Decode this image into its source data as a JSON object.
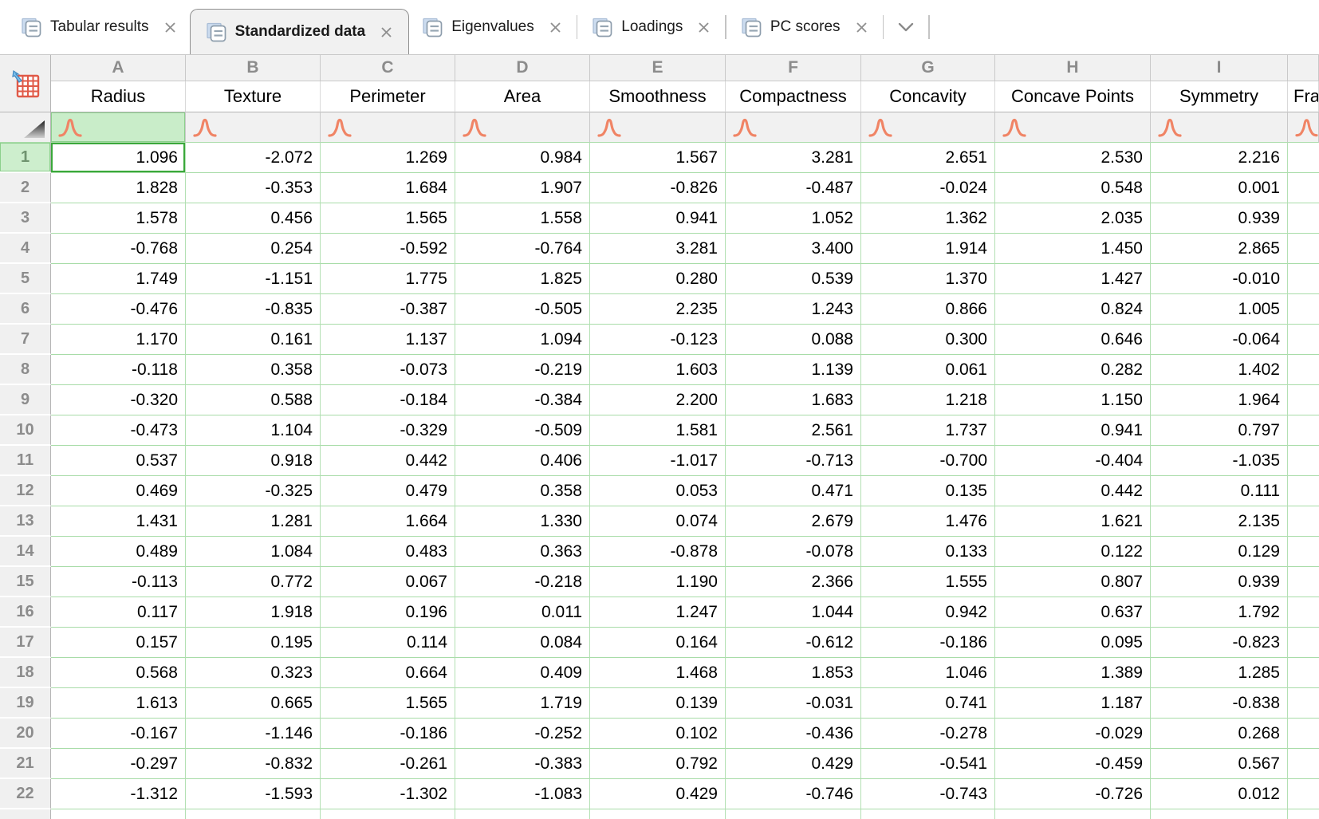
{
  "tabs": {
    "items": [
      {
        "label": "Tabular results",
        "active": false
      },
      {
        "label": "Standardized data",
        "active": true
      },
      {
        "label": "Eigenvalues",
        "active": false
      },
      {
        "label": "Loadings",
        "active": false
      },
      {
        "label": "PC scores",
        "active": false
      }
    ],
    "has_overflow_chevron": true
  },
  "sheet": {
    "column_letters": [
      "A",
      "B",
      "C",
      "D",
      "E",
      "F",
      "G",
      "H",
      "I"
    ],
    "column_names": [
      "Radius",
      "Texture",
      "Perimeter",
      "Area",
      "Smoothness",
      "Compactness",
      "Concavity",
      "Concave Points",
      "Symmetry"
    ],
    "clipped_column_label": "Fra",
    "selection": {
      "row": 1,
      "column": "A"
    },
    "row_numbers": [
      1,
      2,
      3,
      4,
      5,
      6,
      7,
      8,
      9,
      10,
      11,
      12,
      13,
      14,
      15,
      16,
      17,
      18,
      19,
      20,
      21,
      22
    ],
    "rows": [
      [
        "1.096",
        "-2.072",
        "1.269",
        "0.984",
        "1.567",
        "3.281",
        "2.651",
        "2.530",
        "2.216"
      ],
      [
        "1.828",
        "-0.353",
        "1.684",
        "1.907",
        "-0.826",
        "-0.487",
        "-0.024",
        "0.548",
        "0.001"
      ],
      [
        "1.578",
        "0.456",
        "1.565",
        "1.558",
        "0.941",
        "1.052",
        "1.362",
        "2.035",
        "0.939"
      ],
      [
        "-0.768",
        "0.254",
        "-0.592",
        "-0.764",
        "3.281",
        "3.400",
        "1.914",
        "1.450",
        "2.865"
      ],
      [
        "1.749",
        "-1.151",
        "1.775",
        "1.825",
        "0.280",
        "0.539",
        "1.370",
        "1.427",
        "-0.010"
      ],
      [
        "-0.476",
        "-0.835",
        "-0.387",
        "-0.505",
        "2.235",
        "1.243",
        "0.866",
        "0.824",
        "1.005"
      ],
      [
        "1.170",
        "0.161",
        "1.137",
        "1.094",
        "-0.123",
        "0.088",
        "0.300",
        "0.646",
        "-0.064"
      ],
      [
        "-0.118",
        "0.358",
        "-0.073",
        "-0.219",
        "1.603",
        "1.139",
        "0.061",
        "0.282",
        "1.402"
      ],
      [
        "-0.320",
        "0.588",
        "-0.184",
        "-0.384",
        "2.200",
        "1.683",
        "1.218",
        "1.150",
        "1.964"
      ],
      [
        "-0.473",
        "1.104",
        "-0.329",
        "-0.509",
        "1.581",
        "2.561",
        "1.737",
        "0.941",
        "0.797"
      ],
      [
        "0.537",
        "0.918",
        "0.442",
        "0.406",
        "-1.017",
        "-0.713",
        "-0.700",
        "-0.404",
        "-1.035"
      ],
      [
        "0.469",
        "-0.325",
        "0.479",
        "0.358",
        "0.053",
        "0.471",
        "0.135",
        "0.442",
        "0.111"
      ],
      [
        "1.431",
        "1.281",
        "1.664",
        "1.330",
        "0.074",
        "2.679",
        "1.476",
        "1.621",
        "2.135"
      ],
      [
        "0.489",
        "1.084",
        "0.483",
        "0.363",
        "-0.878",
        "-0.078",
        "0.133",
        "0.122",
        "0.129"
      ],
      [
        "-0.113",
        "0.772",
        "0.067",
        "-0.218",
        "1.190",
        "2.366",
        "1.555",
        "0.807",
        "0.939"
      ],
      [
        "0.117",
        "1.918",
        "0.196",
        "0.011",
        "1.247",
        "1.044",
        "0.942",
        "0.637",
        "1.792"
      ],
      [
        "0.157",
        "0.195",
        "0.114",
        "0.084",
        "0.164",
        "-0.612",
        "-0.186",
        "0.095",
        "-0.823"
      ],
      [
        "0.568",
        "0.323",
        "0.664",
        "0.409",
        "1.468",
        "1.853",
        "1.046",
        "1.389",
        "1.285"
      ],
      [
        "1.613",
        "0.665",
        "1.565",
        "1.719",
        "0.139",
        "-0.031",
        "0.741",
        "1.187",
        "-0.838"
      ],
      [
        "-0.167",
        "-1.146",
        "-0.186",
        "-0.252",
        "0.102",
        "-0.436",
        "-0.278",
        "-0.029",
        "0.268"
      ],
      [
        "-0.297",
        "-0.832",
        "-0.261",
        "-0.383",
        "0.792",
        "0.429",
        "-0.541",
        "-0.459",
        "0.567"
      ],
      [
        "-1.312",
        "-1.593",
        "-1.302",
        "-1.083",
        "0.429",
        "-0.746",
        "-0.743",
        "-0.726",
        "0.012"
      ]
    ]
  },
  "colors": {
    "selection_border_green": "#3aa83a",
    "selection_fill_green": "#cdeecd",
    "gridline_green": "#aadcaa",
    "sparkline_salmon": "#f08465",
    "header_bg_gray": "#f0f0f0",
    "header_text_gray": "#8c8c8c",
    "table_icon_red": "#e05a48",
    "table_icon_arrow_blue": "#7ec2ee"
  },
  "icons": {
    "tab_document": "document-icon",
    "tab_close": "close-icon",
    "tab_overflow": "chevron-down-icon",
    "corner_table": "table-select-icon",
    "spark_row_corner": "corner-triangle-icon",
    "distribution": "bell-curve-icon"
  }
}
